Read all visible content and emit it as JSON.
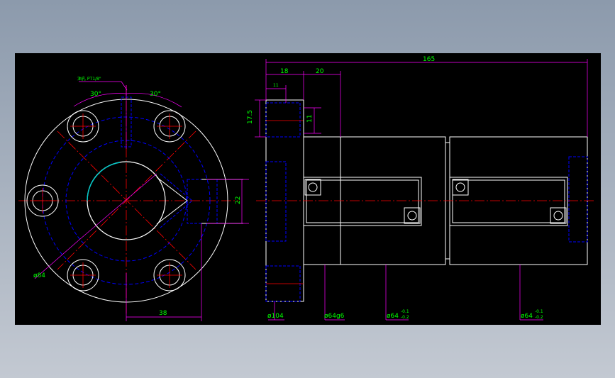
{
  "drawing": {
    "left_view": {
      "thread_label": "油孔 PT1/8\"",
      "angle_left": "30°",
      "angle_right": "30°",
      "dim_22": "22",
      "dim_84": "ø84",
      "dim_38": "38"
    },
    "right_view": {
      "dim_165": "165",
      "dim_18": "18",
      "dim_20": "20",
      "dim_11_top": "11",
      "dim_17_5": "17.5",
      "dim_11_side": "11",
      "dim_d104": "ø104",
      "dim_d64g6": "ø64g6",
      "dim_d64_a": "ø64",
      "tol_a_upper": "-0.1",
      "tol_a_lower": "-0.2",
      "dim_d64_b": "ø64",
      "tol_b_upper": "-0.1",
      "tol_b_lower": "-0.2"
    },
    "colors": {
      "background": "#000000",
      "outline": "#ffffff",
      "hidden": "#0000ff",
      "center": "#ff0000",
      "dimension_line": "#ff00ff",
      "dimension_text": "#00ff00",
      "thread": "#00c8c8"
    }
  }
}
